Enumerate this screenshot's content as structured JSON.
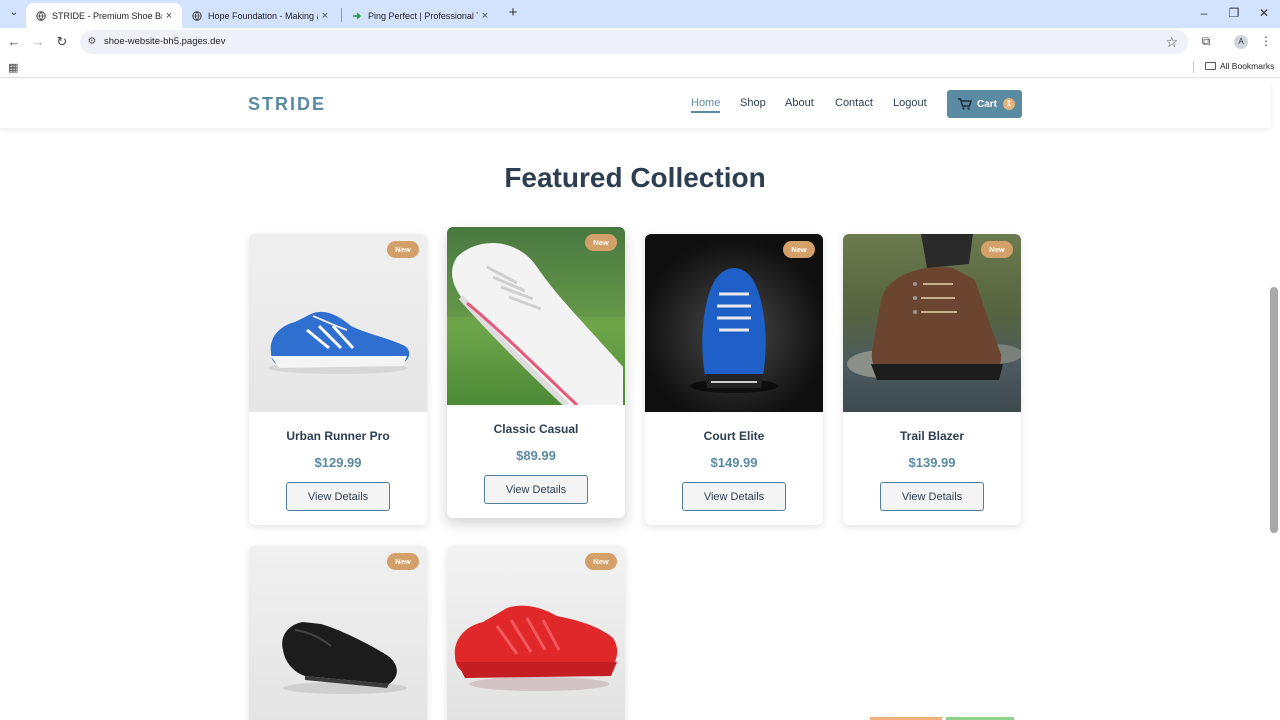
{
  "browser": {
    "tabs": [
      {
        "title": "STRIDE - Premium Shoe Brand",
        "active": true
      },
      {
        "title": "Hope Foundation - Making a Di",
        "active": false
      },
      {
        "title": "Ping Perfect | Professional Train",
        "active": false
      }
    ],
    "url": "shoe-website-bh5.pages.dev",
    "profile_initial": "A",
    "bookmarks_label": "All Bookmarks"
  },
  "site": {
    "logo": "STRIDE",
    "nav": {
      "home": "Home",
      "shop": "Shop",
      "about": "About",
      "contact": "Contact",
      "logout": "Logout"
    },
    "cart": {
      "label": "Cart",
      "count": "1"
    }
  },
  "section": {
    "title": "Featured Collection"
  },
  "products": [
    {
      "badge": "New",
      "name": "Urban Runner Pro",
      "price": "$129.99",
      "button": "View Details",
      "shoe_color": "#2f6fd0"
    },
    {
      "badge": "New",
      "name": "Classic Casual",
      "price": "$89.99",
      "button": "View Details",
      "shoe_color": "#f2f2f2"
    },
    {
      "badge": "New",
      "name": "Court Elite",
      "price": "$149.99",
      "button": "View Details",
      "shoe_color": "#1f5fc8"
    },
    {
      "badge": "New",
      "name": "Trail Blazer",
      "price": "$139.99",
      "button": "View Details",
      "shoe_color": "#6b4530"
    },
    {
      "badge": "New",
      "name": "",
      "price": "",
      "button": "",
      "shoe_color": "#1c1c1c"
    },
    {
      "badge": "New",
      "name": "",
      "price": "",
      "button": "",
      "shoe_color": "#e0282a"
    }
  ],
  "colors": {
    "accent": "#5a8aa0",
    "badge": "#d4a06a",
    "heading": "#2c3e50"
  }
}
